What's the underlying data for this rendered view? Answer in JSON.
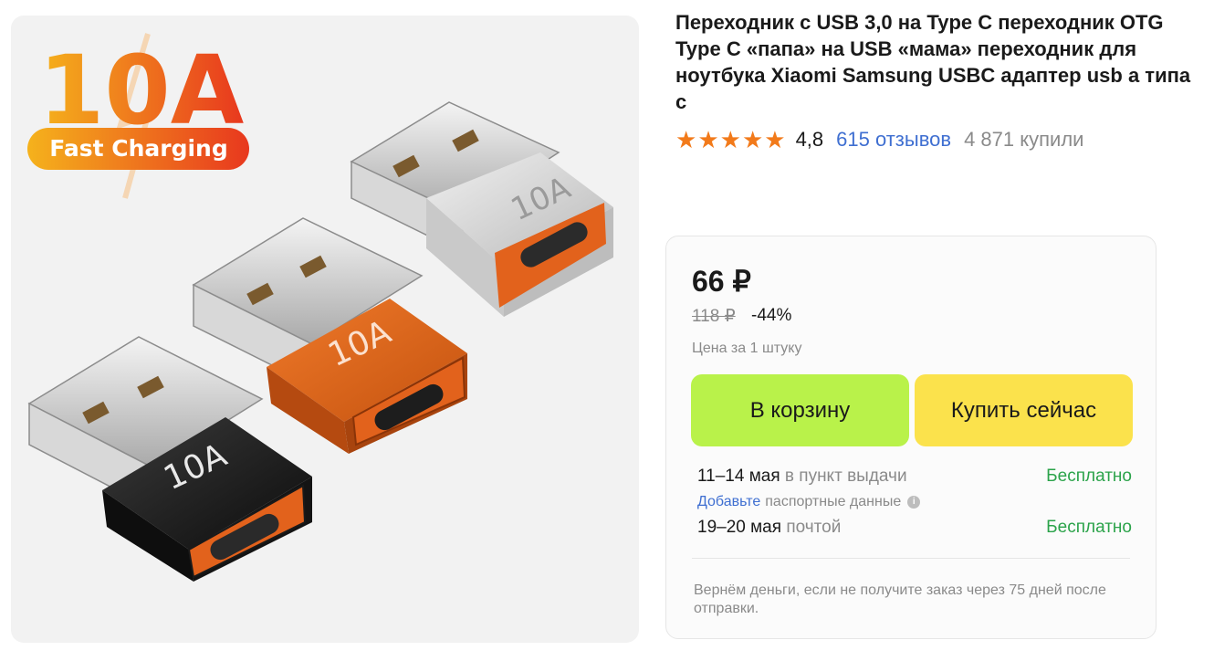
{
  "product": {
    "title": "Переходник с USB 3,0 на Type C переходник OTG Type C «папа» на USB «мама» переходник для ноутбука Xiaomi Samsung USBC адаптер usb а типа с",
    "rating": "4,8",
    "reviews": "615 отзывов",
    "purchased": "4 871 купили",
    "stars_icon": "star-icon",
    "stars_count": 5
  },
  "image": {
    "badge_big": "10A",
    "badge_small": "Fast Charging",
    "adapter_label": "10A",
    "colors": {
      "badge_orange": "#f28a1e",
      "badge_red": "#e83a1e",
      "adapter_orange": "#e2621c",
      "adapter_black": "#1c1c1c",
      "adapter_silver": "#d9d9d9"
    }
  },
  "offer": {
    "price": "66 ₽",
    "old_price": "118 ₽",
    "discount": "-44%",
    "unit_note": "Цена за 1 штуку",
    "cart_button": "В корзину",
    "buy_button": "Купить сейчас",
    "delivery": [
      {
        "date": "11–14 мая",
        "method": "в пункт выдачи",
        "price": "Бесплатно"
      },
      {
        "date": "19–20 мая",
        "method": "почтой",
        "price": "Бесплатно"
      }
    ],
    "passport_link": "Добавьте",
    "passport_text": "паспортные данные",
    "refund_note": "Вернём деньги, если не получите заказ через 75 дней после отправки."
  },
  "colors": {
    "star": "#f27a1a",
    "link": "#3f6fd1",
    "cart_button": "#b9f24a",
    "buy_button": "#fbe24c",
    "free_delivery": "#2ba34a"
  }
}
